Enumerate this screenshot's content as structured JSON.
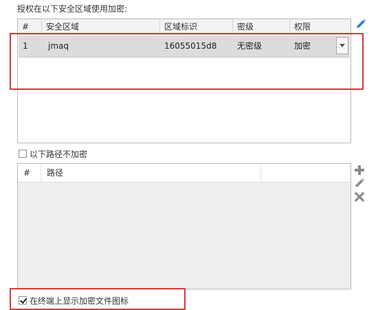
{
  "section_title": "授权在以下安全区域使用加密:",
  "security_table": {
    "columns": [
      "#",
      "安全区域",
      "区域标识",
      "密级",
      "权限"
    ],
    "rows": [
      {
        "index": "1",
        "zone": "jmaq",
        "zone_id": "16055015d8",
        "level": "无密级",
        "permission": "加密"
      }
    ]
  },
  "exclude_paths": {
    "label": "以下路径不加密",
    "checked": false,
    "columns": [
      "#",
      "路径"
    ]
  },
  "show_icon": {
    "label": "在终端上显示加密文件图标",
    "checked": true
  },
  "icons": {
    "edit_zone": "pencil-icon",
    "add_path": "plus-icon",
    "edit_path": "pencil-icon",
    "delete_path": "x-icon"
  },
  "colors": {
    "highlight": "#d9383a",
    "selected_row": "#dcdcdc",
    "icon_blue": "#2b7bd1",
    "icon_gray": "#8a8a8a"
  }
}
